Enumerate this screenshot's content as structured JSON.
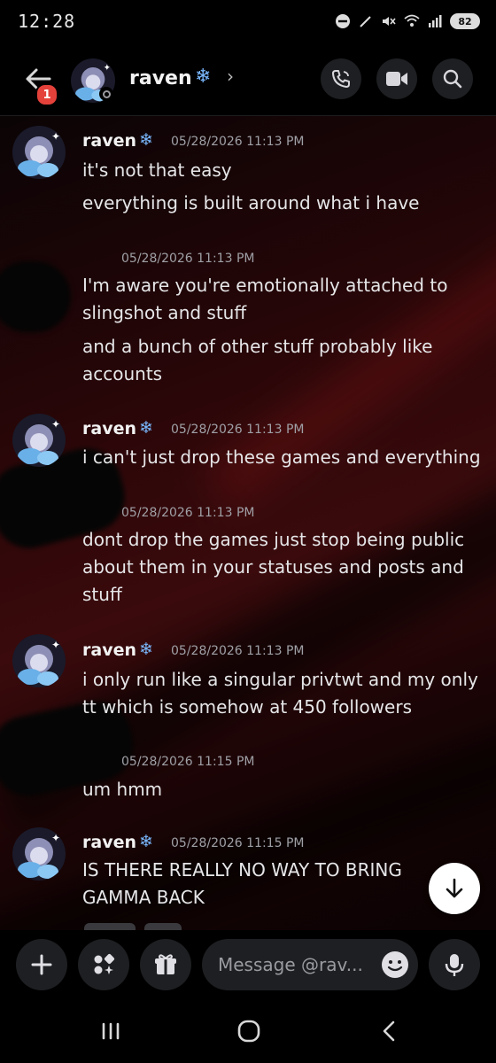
{
  "status_bar": {
    "time": "12:28",
    "battery": "82"
  },
  "header": {
    "contact_name": "raven",
    "unread_count": "1",
    "flake": "❄",
    "chevron": "›"
  },
  "icons": {
    "back": "arrow-left-icon",
    "call": "phone-icon",
    "video": "video-icon",
    "search": "search-icon",
    "add": "plus-icon",
    "apps": "apps-icon",
    "gift": "gift-icon",
    "emoji": "emoji-icon",
    "mic": "microphone-icon",
    "jump": "arrow-down-icon"
  },
  "messages": [
    {
      "author": "raven",
      "flake": "❄",
      "timestamp": "05/28/2026 11:13 PM",
      "lines": [
        "it's not that easy",
        "everything is built around what i have"
      ]
    },
    {
      "author": "",
      "timestamp": "05/28/2026 11:13 PM",
      "lines": [
        "I'm aware you're emotionally attached to slingshot and stuff",
        "and a bunch of other stuff probably like accounts"
      ]
    },
    {
      "author": "raven",
      "flake": "❄",
      "timestamp": "05/28/2026 11:13 PM",
      "lines": [
        "i can't just drop these games and everything"
      ]
    },
    {
      "author": "",
      "timestamp": "05/28/2026 11:13 PM",
      "lines": [
        "dont drop the games just stop being public about them in your statuses and posts and stuff"
      ]
    },
    {
      "author": "raven",
      "flake": "❄",
      "timestamp": "05/28/2026 11:13 PM",
      "lines": [
        "i only run like a singular privtwt and my only tt which is somehow at 450 followers"
      ]
    },
    {
      "author": "",
      "timestamp": "05/28/2026 11:15 PM",
      "lines": [
        "um hmm"
      ]
    },
    {
      "author": "raven",
      "flake": "❄",
      "timestamp": "05/28/2026 11:15 PM",
      "lines": [
        "IS THERE REALLY  NO WAY TO BRING GAMMA BACK"
      ]
    }
  ],
  "composer": {
    "placeholder": "Message @rav..."
  },
  "colors": {
    "accent_flake": "#7ab8ff",
    "badge": "#e5413b",
    "background_tint": "#3a0a0c"
  }
}
